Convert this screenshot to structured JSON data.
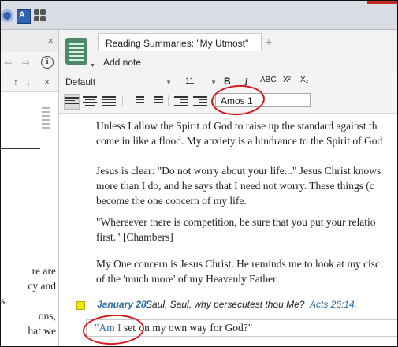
{
  "window": {
    "accent": "#c42b1c"
  },
  "taskbar": {
    "icons": [
      "app-circle-icon",
      "word-style-icon",
      "puzzle-icon"
    ]
  },
  "left_panel": {
    "nav_back": "⇦",
    "nav_forward": "⇨",
    "tool_up": "↑",
    "tool_down": "↓",
    "close": "×",
    "text_lines": [
      "re are",
      "cy and",
      "s",
      "ons,",
      "hat we"
    ]
  },
  "doc_tab": {
    "title": "Reading Summaries: \"My Utmost\"",
    "add_label": "+",
    "add_note": "Add note"
  },
  "format_toolbar": {
    "font": "Default",
    "size": "11",
    "bold": "B",
    "italic": "I",
    "strikethrough": "ABC",
    "superscript": "X²",
    "subscript": "X₂",
    "style_field": "Amos 1"
  },
  "document": {
    "paragraphs": [
      [
        "Unless I allow the Spirit of God to raise up the standard against th",
        "come in like a flood. My anxiety is a hindrance to the Spirit of God"
      ],
      [
        "Jesus is clear: \"Do not worry about your life...\" Jesus Christ knows",
        "more than I do, and he says that I need not worry. These things (c",
        "become the one concern of my life."
      ],
      [
        "\"Whereever there is competition, be sure that you put your relatio",
        "first.\" [Chambers]"
      ],
      [
        "My One concern is Jesus Christ. He reminds me to look at my cisc",
        "of the 'much more' of my Heavenly Father."
      ]
    ],
    "entry": {
      "date": "January 28",
      "title": "Saul, Saul, why persecutest thou Me?",
      "reference": "Acts 26:14."
    },
    "note": {
      "highlight": "\"Am I",
      "rest_before_caret": " set",
      "rest_after_caret": " on my own way for God?\""
    }
  },
  "colors": {
    "link_blue": "#2e6ea6",
    "highlight_yellow": "#f2e600",
    "annotation_red": "#d7191c",
    "icon_green": "#4c8a64"
  }
}
